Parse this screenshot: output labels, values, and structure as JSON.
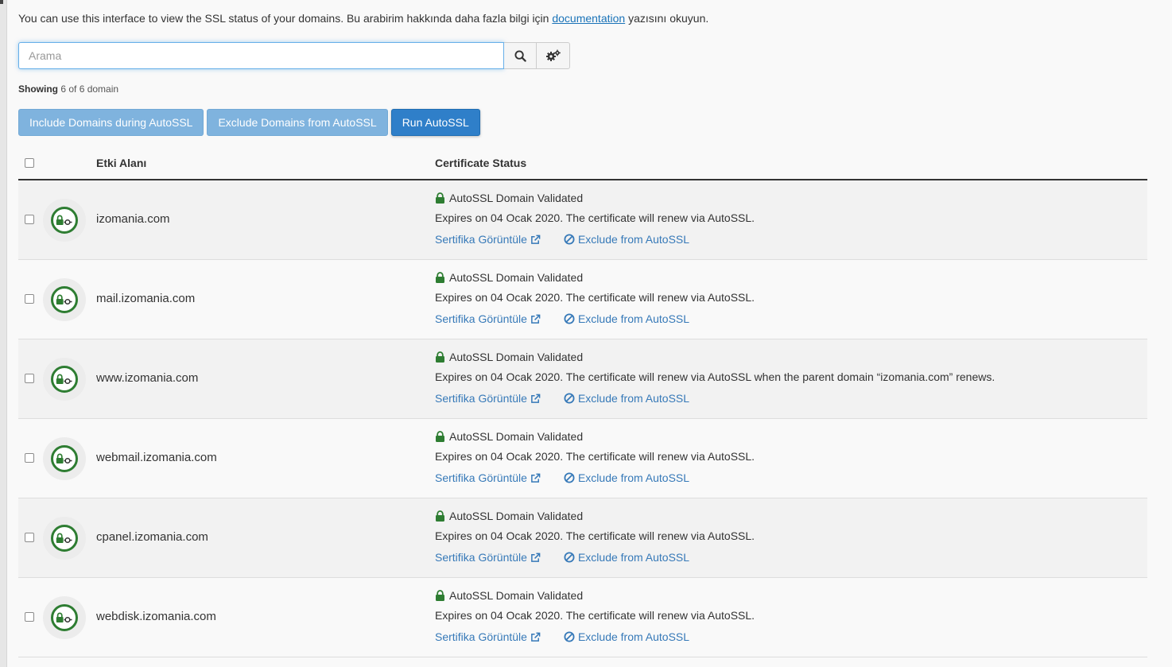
{
  "intro": {
    "text_before": "You can use this interface to view the SSL status of your domains. Bu arabirim hakkında daha fazla bilgi için",
    "link": "documentation",
    "text_after": "yazısını okuyun."
  },
  "search": {
    "placeholder": "Arama",
    "value": ""
  },
  "icons": {
    "search": "search-icon",
    "settings": "gears-icon",
    "lock": "lock-icon",
    "external": "external-link-icon",
    "ban": "ban-icon",
    "ssl_badge": "ssl-lock-badge-icon"
  },
  "showing": {
    "label": "Showing",
    "text": "6 of 6 domain"
  },
  "buttons": {
    "include": "Include Domains during AutoSSL",
    "exclude": "Exclude Domains from AutoSSL",
    "run": "Run AutoSSL"
  },
  "table": {
    "headers": {
      "domain": "Etki Alanı",
      "status": "Certificate Status"
    },
    "rows": [
      {
        "domain": "izomania.com",
        "status": "AutoSSL Domain Validated",
        "expires": "Expires on 04 Ocak 2020. The certificate will renew via AutoSSL.",
        "view": "Sertifika Görüntüle",
        "exclude": "Exclude from AutoSSL"
      },
      {
        "domain": "mail.izomania.com",
        "status": "AutoSSL Domain Validated",
        "expires": "Expires on 04 Ocak 2020. The certificate will renew via AutoSSL.",
        "view": "Sertifika Görüntüle",
        "exclude": "Exclude from AutoSSL"
      },
      {
        "domain": "www.izomania.com",
        "status": "AutoSSL Domain Validated",
        "expires": "Expires on 04 Ocak 2020. The certificate will renew via AutoSSL when the parent domain “izomania.com” renews.",
        "view": "Sertifika Görüntüle",
        "exclude": "Exclude from AutoSSL"
      },
      {
        "domain": "webmail.izomania.com",
        "status": "AutoSSL Domain Validated",
        "expires": "Expires on 04 Ocak 2020. The certificate will renew via AutoSSL.",
        "view": "Sertifika Görüntüle",
        "exclude": "Exclude from AutoSSL"
      },
      {
        "domain": "cpanel.izomania.com",
        "status": "AutoSSL Domain Validated",
        "expires": "Expires on 04 Ocak 2020. The certificate will renew via AutoSSL.",
        "view": "Sertifika Görüntüle",
        "exclude": "Exclude from AutoSSL"
      },
      {
        "domain": "webdisk.izomania.com",
        "status": "AutoSSL Domain Validated",
        "expires": "Expires on 04 Ocak 2020. The certificate will renew via AutoSSL.",
        "view": "Sertifika Görüntüle",
        "exclude": "Exclude from AutoSSL"
      }
    ]
  },
  "colors": {
    "link": "#3679b8",
    "valid": "#2e7d32",
    "primary_button": "#2f7fc9",
    "light_button": "#7fb3de"
  }
}
